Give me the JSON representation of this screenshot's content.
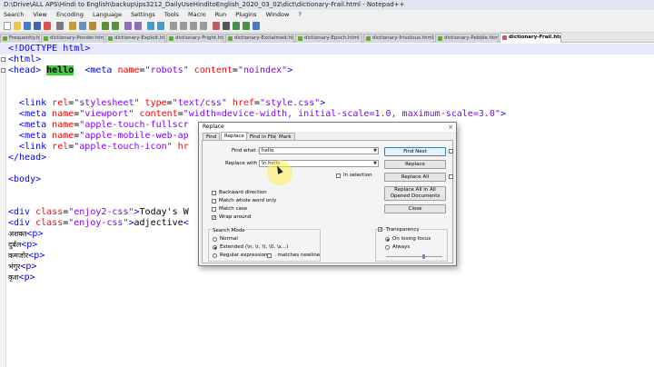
{
  "window": {
    "title": "D:\\Drive\\ALL APS\\Hindi to English\\backup\\ips3212_DailyUseHinditoEnglish_2020_03_02\\dict\\dictionary-Frail.html - Notepad++"
  },
  "menu": [
    "Search",
    "View",
    "Encoding",
    "Language",
    "Settings",
    "Tools",
    "Macro",
    "Run",
    "Plugins",
    "Window",
    "?"
  ],
  "tabs": [
    "Frequently.html",
    "dictionary-Ponder.html",
    "dictionary-Exploit.html",
    "dictionary-Fright.html",
    "dictionary-Exclaimed.html",
    "dictionary-Epoch.html",
    "dictionary-frivolous.html",
    "dictionary-Pebble.html",
    "dictionary-Frail.html"
  ],
  "editor": {
    "lines": [
      {
        "parts": [
          [
            "tag",
            "<!DOCTYPE html>"
          ]
        ]
      },
      {
        "parts": [
          [
            "tag",
            "<html>"
          ]
        ]
      },
      {
        "parts": [
          [
            "tag",
            "<head>"
          ],
          [
            "text",
            " "
          ],
          [
            "hl",
            "hello"
          ],
          [
            "text",
            "  "
          ],
          [
            "tag",
            "<meta "
          ],
          [
            "attr",
            "name"
          ],
          [
            "text",
            "="
          ],
          [
            "val",
            "\"robots\""
          ],
          [
            "text",
            " "
          ],
          [
            "attr",
            "content"
          ],
          [
            "text",
            "="
          ],
          [
            "val",
            "\"noindex\""
          ],
          [
            "tag",
            ">"
          ]
        ]
      },
      {
        "parts": [
          [
            "text",
            ""
          ]
        ]
      },
      {
        "parts": [
          [
            "text",
            "  "
          ],
          [
            "tag",
            "<link "
          ],
          [
            "attr",
            "rel"
          ],
          [
            "text",
            "="
          ],
          [
            "val",
            "\"stylesheet\""
          ],
          [
            "text",
            " "
          ],
          [
            "attr",
            "type"
          ],
          [
            "text",
            "="
          ],
          [
            "val",
            "\"text/css\""
          ],
          [
            "text",
            " "
          ],
          [
            "attr",
            "href"
          ],
          [
            "text",
            "="
          ],
          [
            "val",
            "\"style.css\""
          ],
          [
            "tag",
            ">"
          ]
        ]
      },
      {
        "parts": [
          [
            "text",
            "  "
          ],
          [
            "tag",
            "<meta "
          ],
          [
            "attr",
            "name"
          ],
          [
            "text",
            "="
          ],
          [
            "val",
            "\"viewport\""
          ],
          [
            "text",
            " "
          ],
          [
            "attr",
            "content"
          ],
          [
            "text",
            "="
          ],
          [
            "val",
            "\"width=device-width, initial-scale=1.0, maximum-scale=3.0\""
          ],
          [
            "tag",
            ">"
          ]
        ]
      },
      {
        "parts": [
          [
            "text",
            "  "
          ],
          [
            "tag",
            "<meta "
          ],
          [
            "attr",
            "name"
          ],
          [
            "text",
            "="
          ],
          [
            "val",
            "\"apple-touch-fullscr"
          ]
        ]
      },
      {
        "parts": [
          [
            "text",
            "  "
          ],
          [
            "tag",
            "<meta "
          ],
          [
            "attr",
            "name"
          ],
          [
            "text",
            "="
          ],
          [
            "val",
            "\"apple-mobile-web-ap"
          ]
        ]
      },
      {
        "parts": [
          [
            "text",
            "  "
          ],
          [
            "tag",
            "<link "
          ],
          [
            "attr",
            "rel"
          ],
          [
            "text",
            "="
          ],
          [
            "val",
            "\"apple-touch-icon\""
          ],
          [
            "text",
            " "
          ],
          [
            "attr",
            "hr"
          ]
        ]
      },
      {
        "parts": [
          [
            "tag",
            "</head>"
          ]
        ]
      },
      {
        "parts": [
          [
            "text",
            ""
          ]
        ]
      },
      {
        "parts": [
          [
            "tag",
            "<body>"
          ]
        ]
      },
      {
        "parts": [
          [
            "text",
            ""
          ]
        ]
      },
      {
        "parts": [
          [
            "text",
            ""
          ]
        ]
      },
      {
        "parts": [
          [
            "tag",
            "<div "
          ],
          [
            "attr",
            "class"
          ],
          [
            "text",
            "="
          ],
          [
            "val",
            "\"enjoy2-css\""
          ],
          [
            "tag",
            ">"
          ],
          [
            "text",
            "Today's W"
          ]
        ]
      },
      {
        "parts": [
          [
            "tag",
            "<div "
          ],
          [
            "attr",
            "class"
          ],
          [
            "text",
            "="
          ],
          [
            "val",
            "\"enjoy-css\""
          ],
          [
            "tag",
            ">"
          ],
          [
            "text",
            "adjective"
          ],
          [
            "tag",
            "<"
          ]
        ]
      },
      {
        "parts": [
          [
            "dev",
            "अशक्त"
          ],
          [
            "tag",
            "<p>"
          ]
        ]
      },
      {
        "parts": [
          [
            "dev",
            "दुर्बल"
          ],
          [
            "tag",
            "<p>"
          ]
        ]
      },
      {
        "parts": [
          [
            "dev",
            "कमजोर"
          ],
          [
            "tag",
            "<p>"
          ]
        ]
      },
      {
        "parts": [
          [
            "dev",
            "भंगुर"
          ],
          [
            "tag",
            "<p>"
          ]
        ]
      },
      {
        "parts": [
          [
            "dev",
            "कृश"
          ],
          [
            "tag",
            "<p>"
          ]
        ]
      }
    ]
  },
  "dialog": {
    "title": "Replace",
    "close": "×",
    "tabs": [
      "Find",
      "Replace",
      "Find in Files",
      "Mark"
    ],
    "find_label": "Find what :",
    "find_value": "hello",
    "replace_label": "Replace with :",
    "replace_value": "\\n hello",
    "in_selection": "In selection",
    "buttons": {
      "find_next": "Find Next",
      "replace": "Replace",
      "replace_all": "Replace All",
      "replace_all_open": "Replace All in All Opened Documents",
      "close": "Close"
    },
    "options": {
      "backward": "Backward direction",
      "whole_word": "Match whole word only",
      "match_case": "Match case",
      "wrap_around": "Wrap around"
    },
    "search_mode": {
      "title": "Search Mode",
      "normal": "Normal",
      "extended": "Extended (\\n, \\r, \\t, \\0, \\x...)",
      "regex": "Regular expression",
      "matches_newline": ". matches newline"
    },
    "transparency": {
      "title": "Transparency",
      "on_losing_focus": "On losing focus",
      "always": "Always"
    }
  }
}
